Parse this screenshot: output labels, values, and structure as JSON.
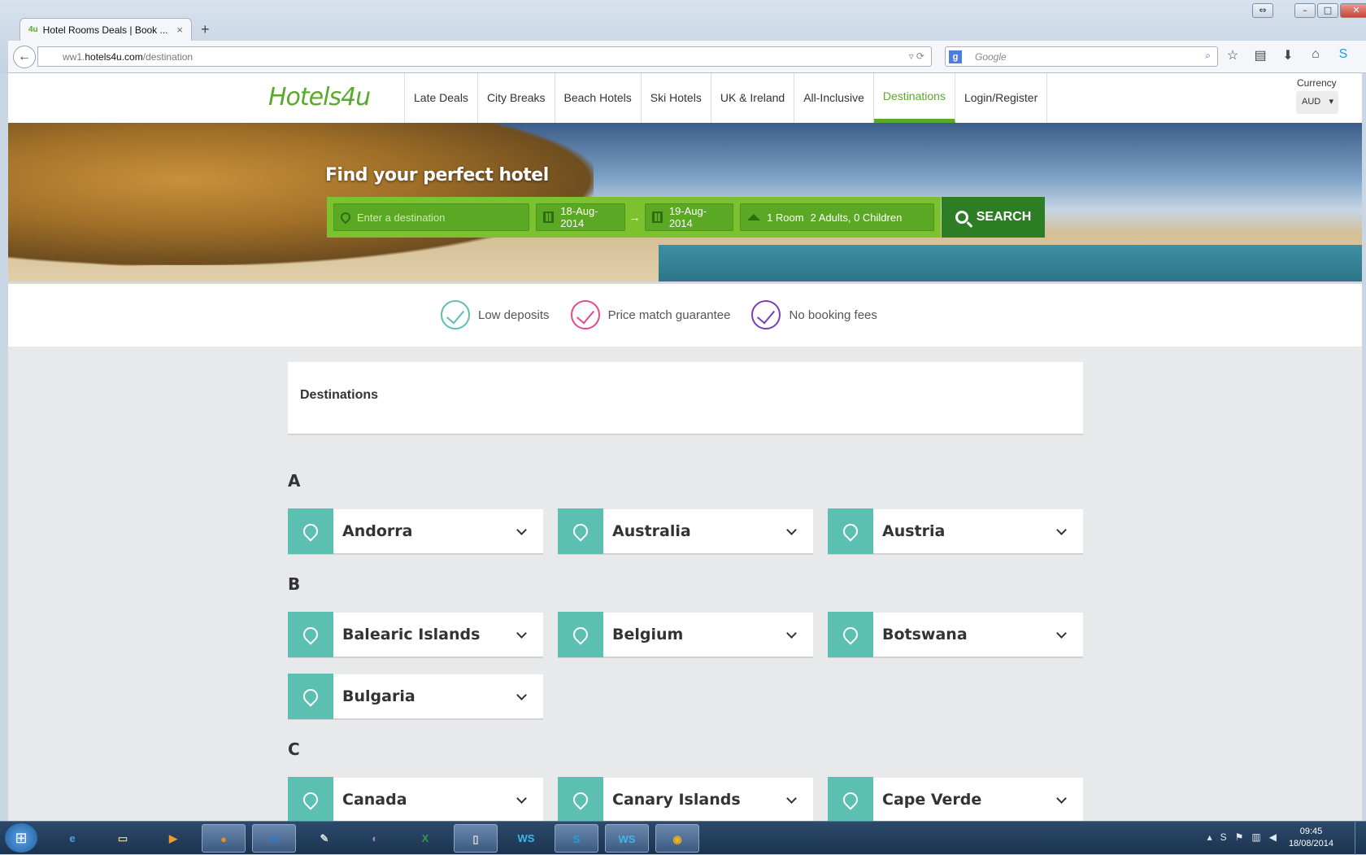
{
  "browser": {
    "tab_title": "Hotel Rooms Deals | Book ...",
    "tab_favicon": "4u",
    "tab_close": "×",
    "new_tab": "+",
    "url_prefix": "ww1.",
    "url_domain": "hotels4u.com",
    "url_path": "/destination",
    "search_engine": "Google",
    "search_placeholder": "Google"
  },
  "site": {
    "logo": "Hotels4u",
    "nav": [
      "Late Deals",
      "City Breaks",
      "Beach Hotels",
      "Ski Hotels",
      "UK & Ireland",
      "All-Inclusive",
      "Destinations",
      "Login/Register"
    ],
    "active_nav": "Destinations",
    "currency_label": "Currency",
    "currency_value": "AUD"
  },
  "hero": {
    "title": "Find your perfect hotel",
    "destination_placeholder": "Enter a destination",
    "checkin": "18-Aug-2014",
    "checkout": "19-Aug-2014",
    "rooms": "1 Room",
    "guests": "2 Adults, 0 Children",
    "search_label": "SEARCH"
  },
  "usps": [
    {
      "label": "Low deposits",
      "color": "#5bbfb2"
    },
    {
      "label": "Price match guarantee",
      "color": "#e6488f"
    },
    {
      "label": "No booking fees",
      "color": "#7c3cba"
    }
  ],
  "page_title": "Destinations",
  "groups": [
    {
      "letter": "A",
      "countries": [
        "Andorra",
        "Australia",
        "Austria"
      ]
    },
    {
      "letter": "B",
      "countries": [
        "Balearic Islands",
        "Belgium",
        "Botswana",
        "Bulgaria"
      ]
    },
    {
      "letter": "C",
      "countries": [
        "Canada",
        "Canary Islands",
        "Cape Verde"
      ]
    }
  ],
  "taskbar": {
    "time": "09:45",
    "date": "18/08/2014",
    "apps": [
      "ie-icon",
      "explorer-icon",
      "media-player-icon",
      "firefox-icon",
      "outlook-icon",
      "paint-icon",
      "eclipse-icon",
      "excel-icon",
      "cmd-icon",
      "webstorm-icon",
      "skype-icon",
      "webstorm-icon-2",
      "chrome-icon"
    ]
  },
  "colors": {
    "brand_green": "#5aaa2a",
    "search_bar": "#7bc22e",
    "search_button": "#2d7d25",
    "teal": "#5bbfb2"
  }
}
